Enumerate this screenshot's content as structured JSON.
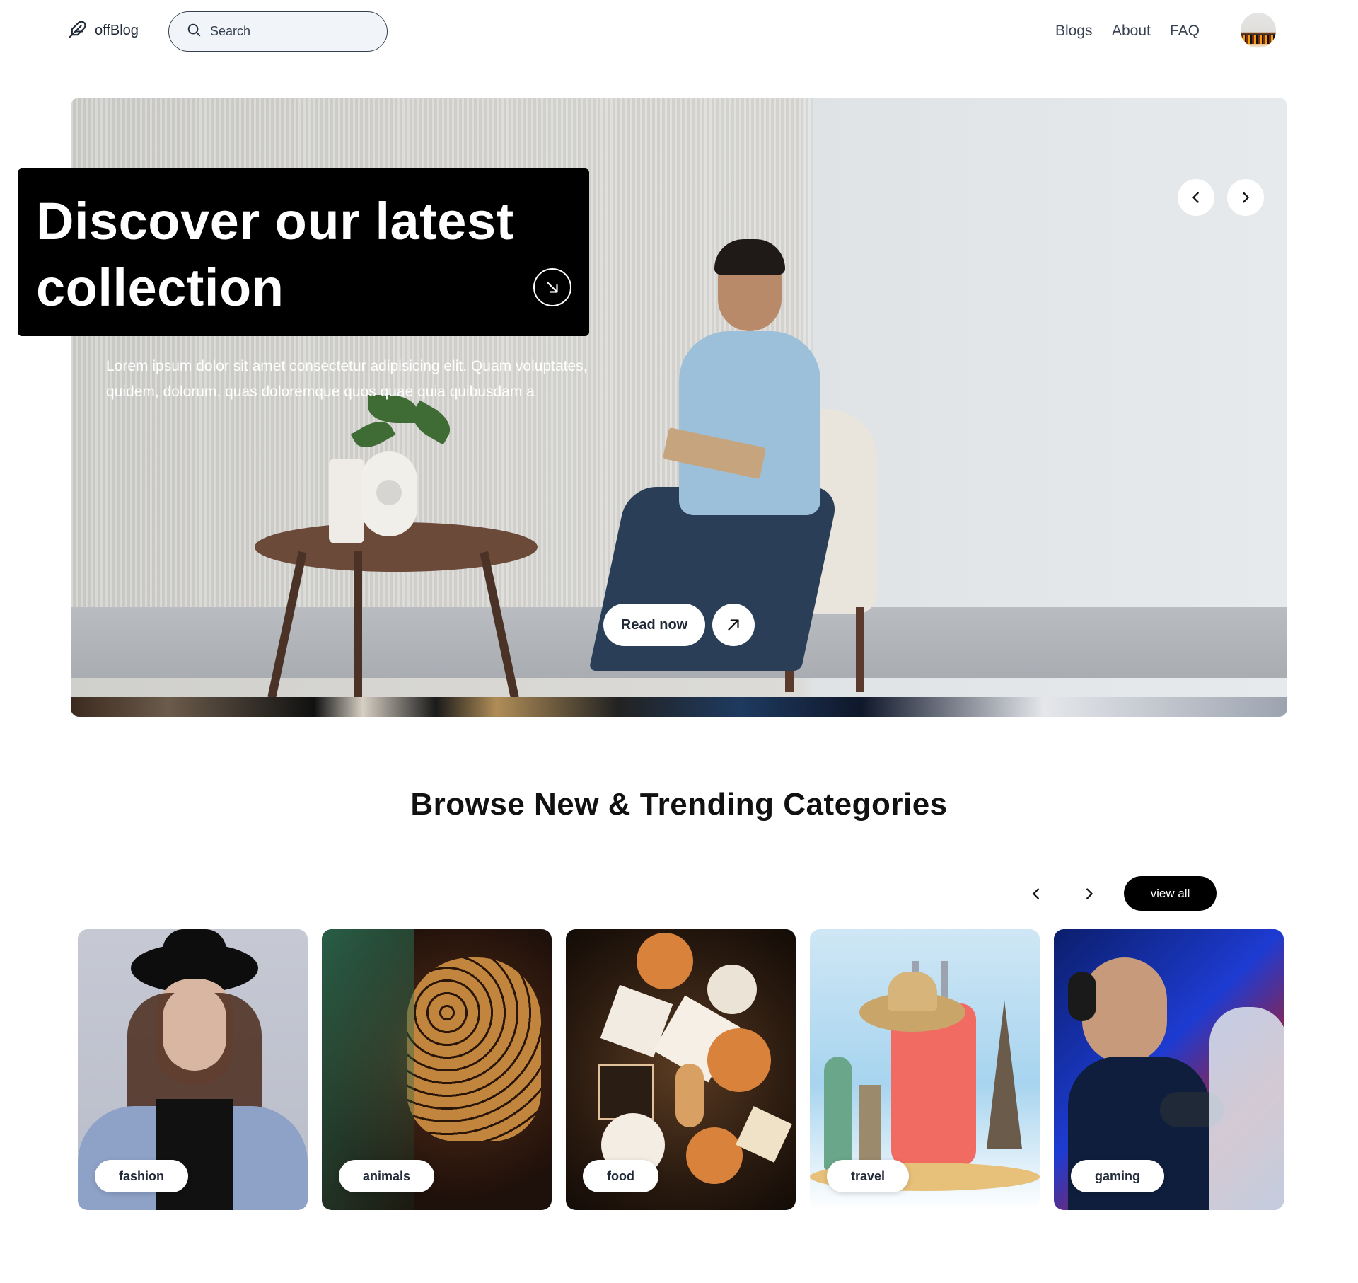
{
  "header": {
    "logo_text": "offBlog",
    "search_placeholder": "Search",
    "nav": [
      "Blogs",
      "About",
      "FAQ"
    ]
  },
  "hero": {
    "title": "Discover our latest collection",
    "description": "Lorem ipsum dolor sit amet consectetur adipisicing elit. Quam voluptates, quidem, dolorum, quas doloremque quos quae quia quibusdam a",
    "read_now_label": "Read now"
  },
  "categories": {
    "title": "Browse New & Trending Categories",
    "view_all_label": "view all",
    "items": [
      "fashion",
      "animals",
      "food",
      "travel",
      "gaming"
    ]
  },
  "colors": {
    "accent": "#000000",
    "text": "#1f2937",
    "search_bg": "#f1f5f9"
  }
}
